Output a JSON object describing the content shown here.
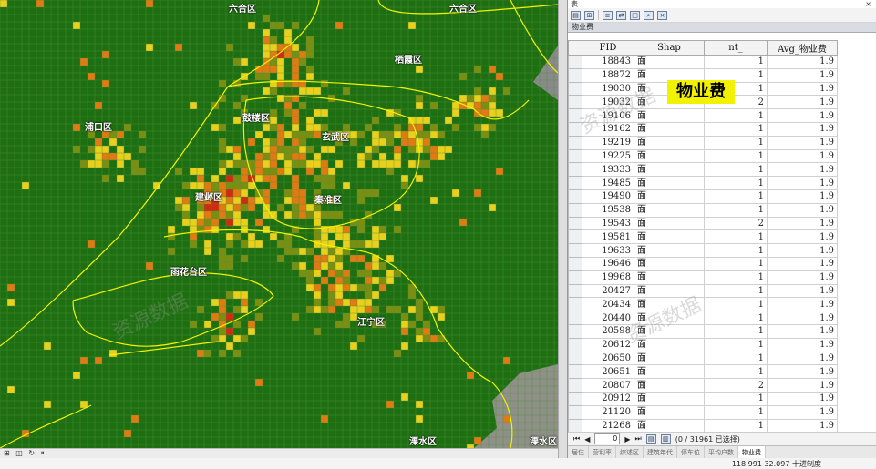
{
  "map": {
    "districts": [
      {
        "name": "六合区"
      },
      {
        "name": "六合区"
      },
      {
        "name": "栖霞区"
      },
      {
        "name": "浦口区"
      },
      {
        "name": "鼓楼区"
      },
      {
        "name": "玄武区"
      },
      {
        "name": "建邺区"
      },
      {
        "name": "秦淮区"
      },
      {
        "name": "雨花台区"
      },
      {
        "name": "江宁区"
      },
      {
        "name": "溧水区"
      },
      {
        "name": "溧水区"
      }
    ],
    "colors": {
      "background": "#1e6f12",
      "grid": "#4f8f3d",
      "boundary": "#f3f200",
      "low": "#7a8f12",
      "mid": "#e8d01c",
      "high": "#e07a12",
      "max": "#d02a10"
    }
  },
  "map_toolbar": {
    "items": [
      "⊞",
      "◫",
      "↻",
      "⏸"
    ]
  },
  "table_window": {
    "title": "表",
    "close": "×",
    "tab_name": "物业费",
    "columns": [
      "FID",
      "Shap",
      "nt_",
      "Avg_物业费"
    ],
    "highlight_label": "物业费",
    "rows": [
      {
        "fid": "18843",
        "shape": "面",
        "count": "1",
        "avg": "1.9"
      },
      {
        "fid": "18872",
        "shape": "面",
        "count": "1",
        "avg": "1.9"
      },
      {
        "fid": "19030",
        "shape": "面",
        "count": "1",
        "avg": "1.9"
      },
      {
        "fid": "19032",
        "shape": "面",
        "count": "2",
        "avg": "1.9"
      },
      {
        "fid": "19106",
        "shape": "面",
        "count": "1",
        "avg": "1.9"
      },
      {
        "fid": "19162",
        "shape": "面",
        "count": "1",
        "avg": "1.9"
      },
      {
        "fid": "19219",
        "shape": "面",
        "count": "1",
        "avg": "1.9"
      },
      {
        "fid": "19225",
        "shape": "面",
        "count": "1",
        "avg": "1.9"
      },
      {
        "fid": "19333",
        "shape": "面",
        "count": "1",
        "avg": "1.9"
      },
      {
        "fid": "19485",
        "shape": "面",
        "count": "1",
        "avg": "1.9"
      },
      {
        "fid": "19490",
        "shape": "面",
        "count": "1",
        "avg": "1.9"
      },
      {
        "fid": "19538",
        "shape": "面",
        "count": "1",
        "avg": "1.9"
      },
      {
        "fid": "19543",
        "shape": "面",
        "count": "2",
        "avg": "1.9"
      },
      {
        "fid": "19581",
        "shape": "面",
        "count": "1",
        "avg": "1.9"
      },
      {
        "fid": "19633",
        "shape": "面",
        "count": "1",
        "avg": "1.9"
      },
      {
        "fid": "19646",
        "shape": "面",
        "count": "1",
        "avg": "1.9"
      },
      {
        "fid": "19968",
        "shape": "面",
        "count": "1",
        "avg": "1.9"
      },
      {
        "fid": "20427",
        "shape": "面",
        "count": "1",
        "avg": "1.9"
      },
      {
        "fid": "20434",
        "shape": "面",
        "count": "1",
        "avg": "1.9"
      },
      {
        "fid": "20440",
        "shape": "面",
        "count": "1",
        "avg": "1.9"
      },
      {
        "fid": "20598",
        "shape": "面",
        "count": "1",
        "avg": "1.9"
      },
      {
        "fid": "20612",
        "shape": "面",
        "count": "1",
        "avg": "1.9"
      },
      {
        "fid": "20650",
        "shape": "面",
        "count": "1",
        "avg": "1.9"
      },
      {
        "fid": "20651",
        "shape": "面",
        "count": "1",
        "avg": "1.9"
      },
      {
        "fid": "20807",
        "shape": "面",
        "count": "2",
        "avg": "1.9"
      },
      {
        "fid": "20912",
        "shape": "面",
        "count": "1",
        "avg": "1.9"
      },
      {
        "fid": "21120",
        "shape": "面",
        "count": "1",
        "avg": "1.9"
      },
      {
        "fid": "21268",
        "shape": "面",
        "count": "1",
        "avg": "1.9"
      }
    ],
    "nav": {
      "first": "⏮",
      "prev": "◀",
      "record": "0",
      "next": "▶",
      "last": "⏭",
      "count_text": "(0 / 31961 已选择)"
    },
    "bottom_tabs": [
      "居住",
      "营利率",
      "综述区",
      "建筑年代",
      "停车位",
      "平均户数",
      "物业费"
    ],
    "active_tab": "物业费"
  },
  "status": {
    "coords": "118.991  32.097 十进制度",
    "units": ""
  },
  "watermark": {
    "text": "资源数据"
  }
}
